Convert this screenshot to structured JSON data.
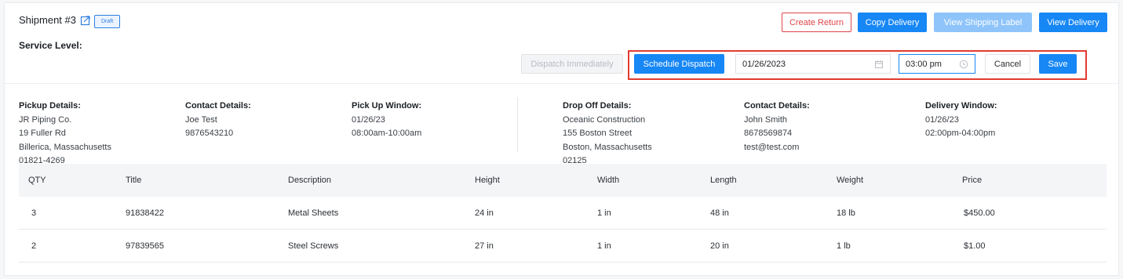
{
  "shipment": {
    "title": "Shipment #3",
    "badge": "Draft",
    "service_level_label": "Service Level:"
  },
  "actions": {
    "create_return": "Create Return",
    "copy_delivery": "Copy Delivery",
    "view_shipping_label": "View Shipping Label",
    "view_delivery": "View Delivery"
  },
  "dispatch": {
    "dispatch_immediately": "Dispatch Immediately",
    "schedule_dispatch": "Schedule Dispatch",
    "date_value": "01/26/2023",
    "time_value": "03:00 pm",
    "cancel": "Cancel",
    "save": "Save"
  },
  "pickup": {
    "heading": "Pickup Details:",
    "lines": [
      "JR Piping Co.",
      "19 Fuller Rd",
      "Billerica, Massachusetts",
      "01821-4269"
    ]
  },
  "pickup_contact": {
    "heading": "Contact Details:",
    "lines": [
      "Joe Test",
      "9876543210"
    ]
  },
  "pickup_window": {
    "heading": "Pick Up Window:",
    "lines": [
      "01/26/23",
      "08:00am-10:00am"
    ]
  },
  "dropoff": {
    "heading": "Drop Off Details:",
    "lines": [
      "Oceanic Construction",
      "155 Boston Street",
      "Boston, Massachusetts",
      "02125"
    ]
  },
  "dropoff_contact": {
    "heading": "Contact Details:",
    "lines": [
      "John Smith",
      "8678569874",
      "test@test.com"
    ]
  },
  "delivery_window": {
    "heading": "Delivery Window:",
    "lines": [
      "01/26/23",
      "02:00pm-04:00pm"
    ]
  },
  "table": {
    "headers": [
      "QTY",
      "Title",
      "Description",
      "Height",
      "Width",
      "Length",
      "Weight",
      "Price"
    ],
    "rows": [
      [
        "3",
        "91838422",
        "Metal Sheets",
        "24 in",
        "1 in",
        "48 in",
        "18 lb",
        "$450.00"
      ],
      [
        "2",
        "97839565",
        "Steel Screws",
        "27 in",
        "1 in",
        "20 in",
        "1 lb",
        "$1.00"
      ]
    ]
  },
  "colors": {
    "primary": "#1787f5",
    "danger": "#e0454a",
    "highlight": "#e23b30"
  }
}
